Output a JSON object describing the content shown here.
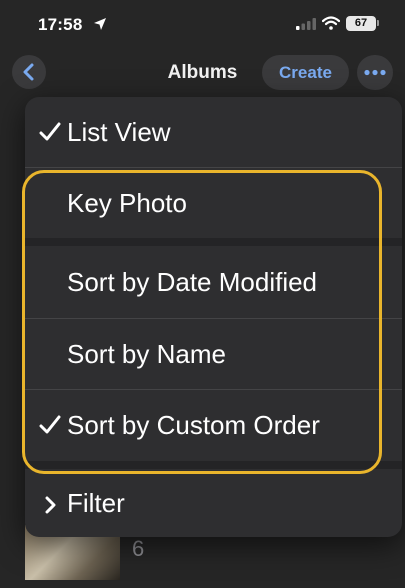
{
  "status_bar": {
    "time": "17:58",
    "battery": "67"
  },
  "nav": {
    "title": "Albums",
    "create_label": "Create"
  },
  "menu": {
    "items": [
      {
        "label": "List View",
        "checked": true
      },
      {
        "label": "Key Photo",
        "checked": false
      },
      {
        "label": "Sort by Date Modified",
        "checked": false
      },
      {
        "label": "Sort by Name",
        "checked": false
      },
      {
        "label": "Sort by Custom Order",
        "checked": true
      },
      {
        "label": "Filter",
        "submenu": true
      }
    ]
  },
  "background": {
    "album_count": "6"
  },
  "colors": {
    "accent": "#7aaaf0",
    "highlight": "#e9b52c",
    "menu_bg": "#2e2e30"
  }
}
